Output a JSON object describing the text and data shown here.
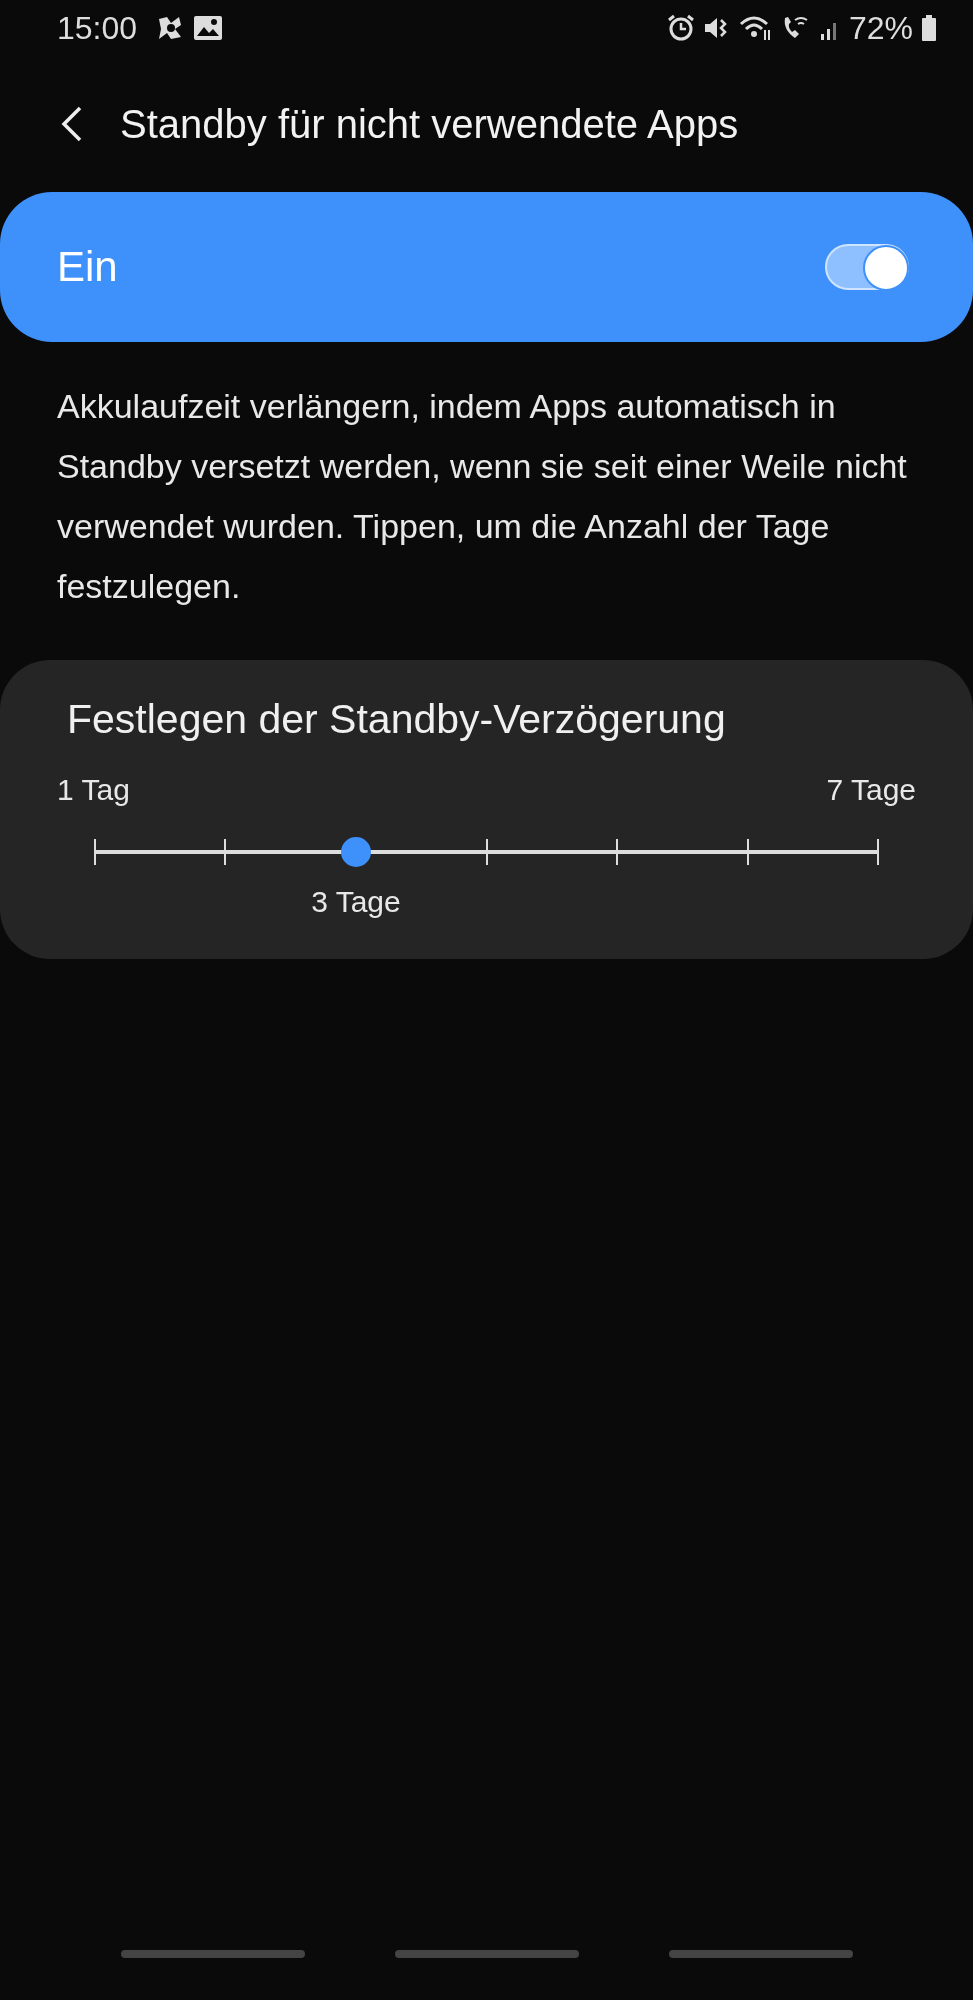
{
  "status_bar": {
    "time": "15:00",
    "battery": "72%"
  },
  "header": {
    "title": "Standby für nicht verwendete Apps"
  },
  "master_switch": {
    "label": "Ein",
    "on": true
  },
  "description": "Akkulaufzeit verlängern, indem Apps automatisch in Standby versetzt werden, wenn sie seit einer Weile nicht verwendet wurden. Tippen, um die Anzahl der Tage festzulegen.",
  "delay_card": {
    "title": "Festlegen der Standby-Verzögerung",
    "min_label": "1 Tag",
    "max_label": "7 Tage",
    "level": 0.3333,
    "value_label": "3 Tage"
  }
}
